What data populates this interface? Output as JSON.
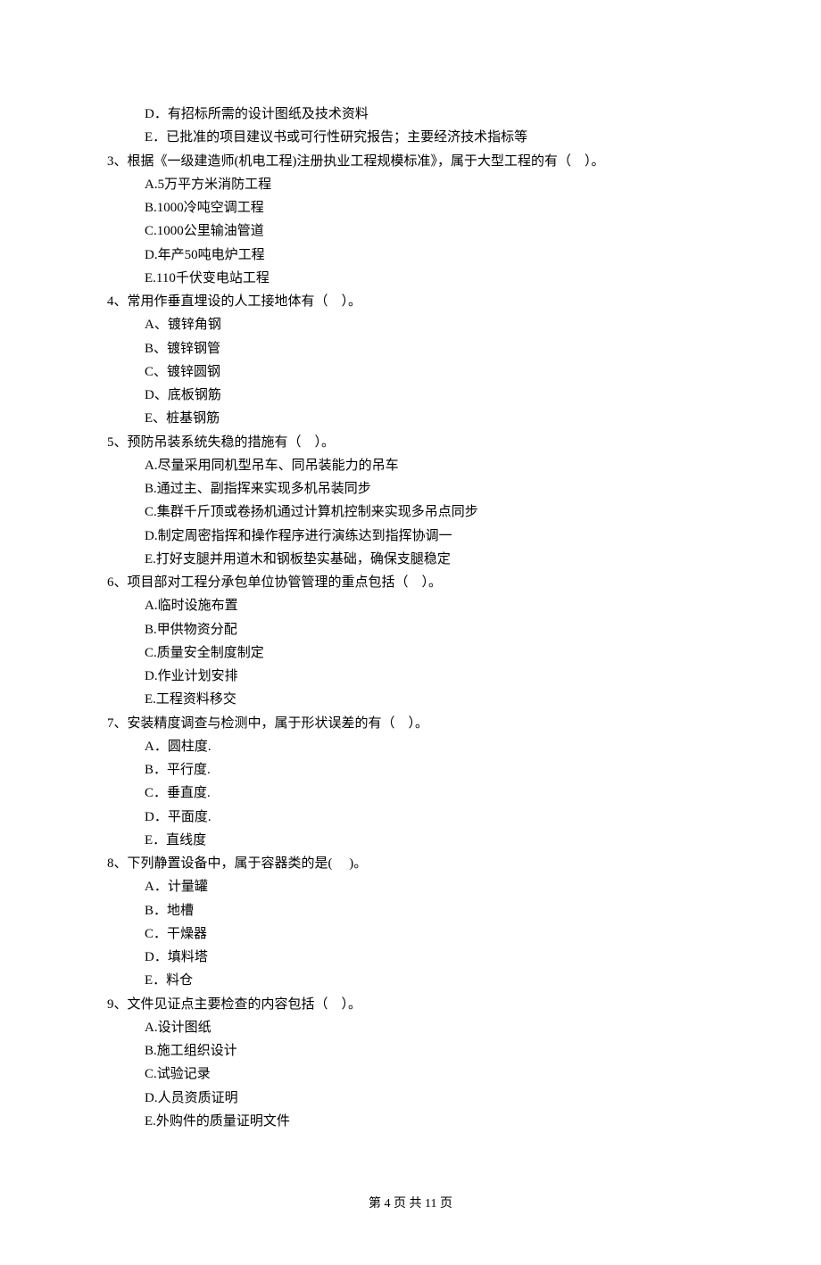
{
  "orphan_options": [
    "D．有招标所需的设计图纸及技术资料",
    "E．已批准的项目建议书或可行性研究报告；主要经济技术指标等"
  ],
  "questions": [
    {
      "num": "3",
      "stem": "根据《一级建造师(机电工程)注册执业工程规模标准》，属于大型工程的有（    ）。",
      "options": [
        "A.5万平方米消防工程",
        "B.1000冷吨空调工程",
        "C.1000公里输油管道",
        "D.年产50吨电炉工程",
        "E.110千伏变电站工程"
      ]
    },
    {
      "num": "4",
      "stem": "常用作垂直埋设的人工接地体有（    ）。",
      "options": [
        "A、镀锌角钢",
        "B、镀锌钢管",
        "C、镀锌圆钢",
        "D、底板钢筋",
        "E、桩基钢筋"
      ]
    },
    {
      "num": "5",
      "stem": "预防吊装系统失稳的措施有（    ）。",
      "options": [
        "A.尽量采用同机型吊车、同吊装能力的吊车",
        "B.通过主、副指挥来实现多机吊装同步",
        "C.集群千斤顶或卷扬机通过计算机控制来实现多吊点同步",
        "D.制定周密指挥和操作程序进行演练达到指挥协调一",
        "E.打好支腿并用道木和钢板垫实基础，确保支腿稳定"
      ]
    },
    {
      "num": "6",
      "stem": "项目部对工程分承包单位协管管理的重点包括（    ）。",
      "options": [
        "A.临时设施布置",
        "B.甲供物资分配",
        "C.质量安全制度制定",
        "D.作业计划安排",
        "E.工程资料移交"
      ]
    },
    {
      "num": "7",
      "stem": "安装精度调查与检测中，属于形状误差的有（    ）。",
      "options": [
        "A．圆柱度.",
        "B．平行度.",
        "C．垂直度.",
        "D．平面度.",
        "E．直线度"
      ]
    },
    {
      "num": "8",
      "stem": "下列静置设备中，属于容器类的是(     )。",
      "options": [
        "A．计量罐",
        "B．地槽",
        "C．干燥器",
        "D．填料塔",
        "E．料仓"
      ]
    },
    {
      "num": "9",
      "stem": "文件见证点主要检查的内容包括（    ）。",
      "options": [
        "A.设计图纸",
        "B.施工组织设计",
        "C.试验记录",
        "D.人员资质证明",
        "E.外购件的质量证明文件"
      ]
    }
  ],
  "footer": "第 4 页 共 11 页"
}
